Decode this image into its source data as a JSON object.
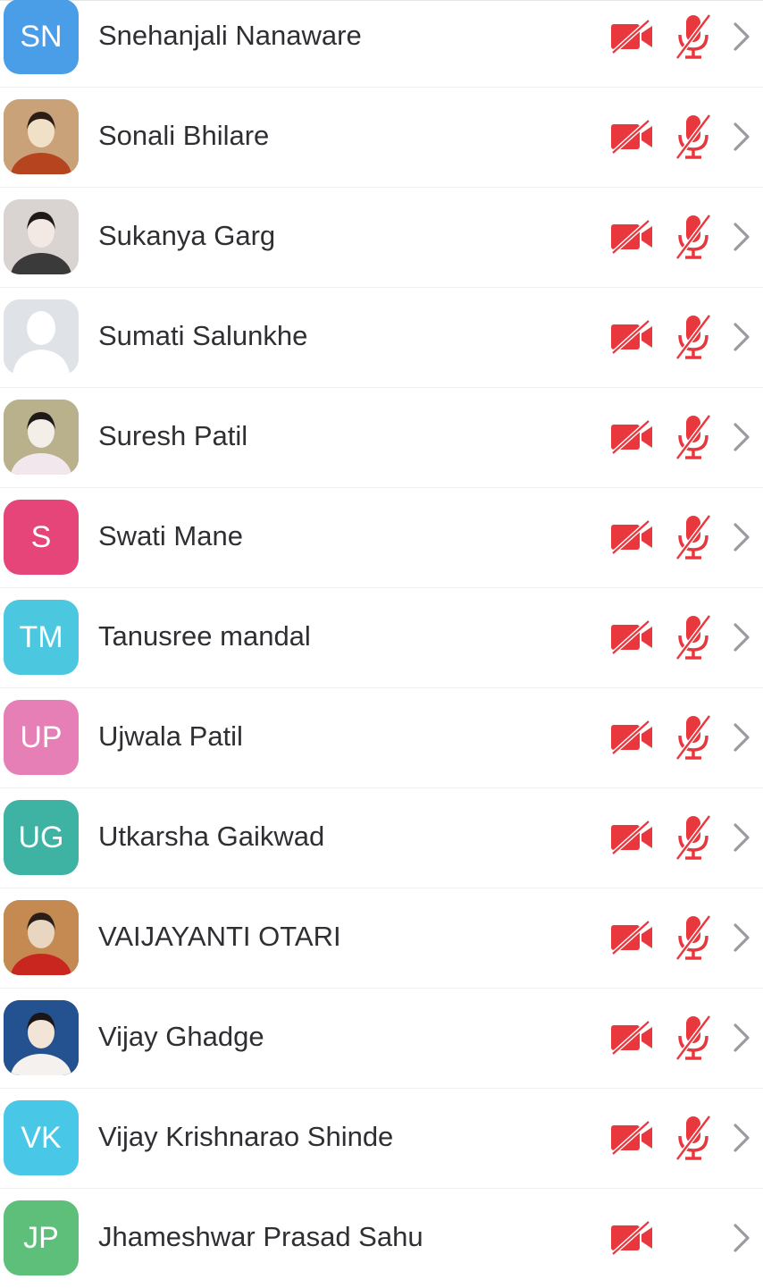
{
  "participants": [
    {
      "name": "Snehanjali Nanaware",
      "initials": "SN",
      "avatar_color": "#4a9ee8",
      "avatar_type": "initials",
      "video_muted": true,
      "audio_muted": true
    },
    {
      "name": "Sonali Bhilare",
      "initials": "",
      "avatar_color": "#c98a4a",
      "avatar_type": "photo",
      "video_muted": true,
      "audio_muted": true
    },
    {
      "name": "Sukanya Garg",
      "initials": "",
      "avatar_color": "#d7d2cf",
      "avatar_type": "photo",
      "video_muted": true,
      "audio_muted": true
    },
    {
      "name": "Sumati Salunkhe",
      "initials": "",
      "avatar_color": "#dfe2e7",
      "avatar_type": "default-person",
      "video_muted": true,
      "audio_muted": true
    },
    {
      "name": "Suresh Patil",
      "initials": "",
      "avatar_color": "#b6a07e",
      "avatar_type": "photo",
      "video_muted": true,
      "audio_muted": true
    },
    {
      "name": "Swati Mane",
      "initials": "S",
      "avatar_color": "#e6457a",
      "avatar_type": "initials",
      "video_muted": true,
      "audio_muted": true
    },
    {
      "name": "Tanusree mandal",
      "initials": "TM",
      "avatar_color": "#4cc7e0",
      "avatar_type": "initials",
      "video_muted": true,
      "audio_muted": true
    },
    {
      "name": "Ujwala Patil",
      "initials": "UP",
      "avatar_color": "#e67fb5",
      "avatar_type": "initials",
      "video_muted": true,
      "audio_muted": true
    },
    {
      "name": "Utkarsha Gaikwad",
      "initials": "UG",
      "avatar_color": "#3fb3a3",
      "avatar_type": "initials",
      "video_muted": true,
      "audio_muted": true
    },
    {
      "name": "VAIJAYANTI OTARI",
      "initials": "",
      "avatar_color": "#8a6a4a",
      "avatar_type": "photo",
      "video_muted": true,
      "audio_muted": true
    },
    {
      "name": "Vijay Ghadge",
      "initials": "",
      "avatar_color": "#1c3f7a",
      "avatar_type": "photo",
      "video_muted": true,
      "audio_muted": true
    },
    {
      "name": "Vijay Krishnarao Shinde",
      "initials": "VK",
      "avatar_color": "#49c7e6",
      "avatar_type": "initials",
      "video_muted": true,
      "audio_muted": true
    },
    {
      "name": "Jhameshwar Prasad Sahu",
      "initials": "JP",
      "avatar_color": "#5dbf7a",
      "avatar_type": "initials",
      "video_muted": true,
      "audio_muted": false
    }
  ],
  "icons": {
    "video": "video-off-icon",
    "audio": "mic-off-icon",
    "chevron": "chevron-right-icon"
  },
  "colors": {
    "muted": "#e8383e",
    "chevron": "#9a9aa0",
    "text": "#2f2f33"
  }
}
